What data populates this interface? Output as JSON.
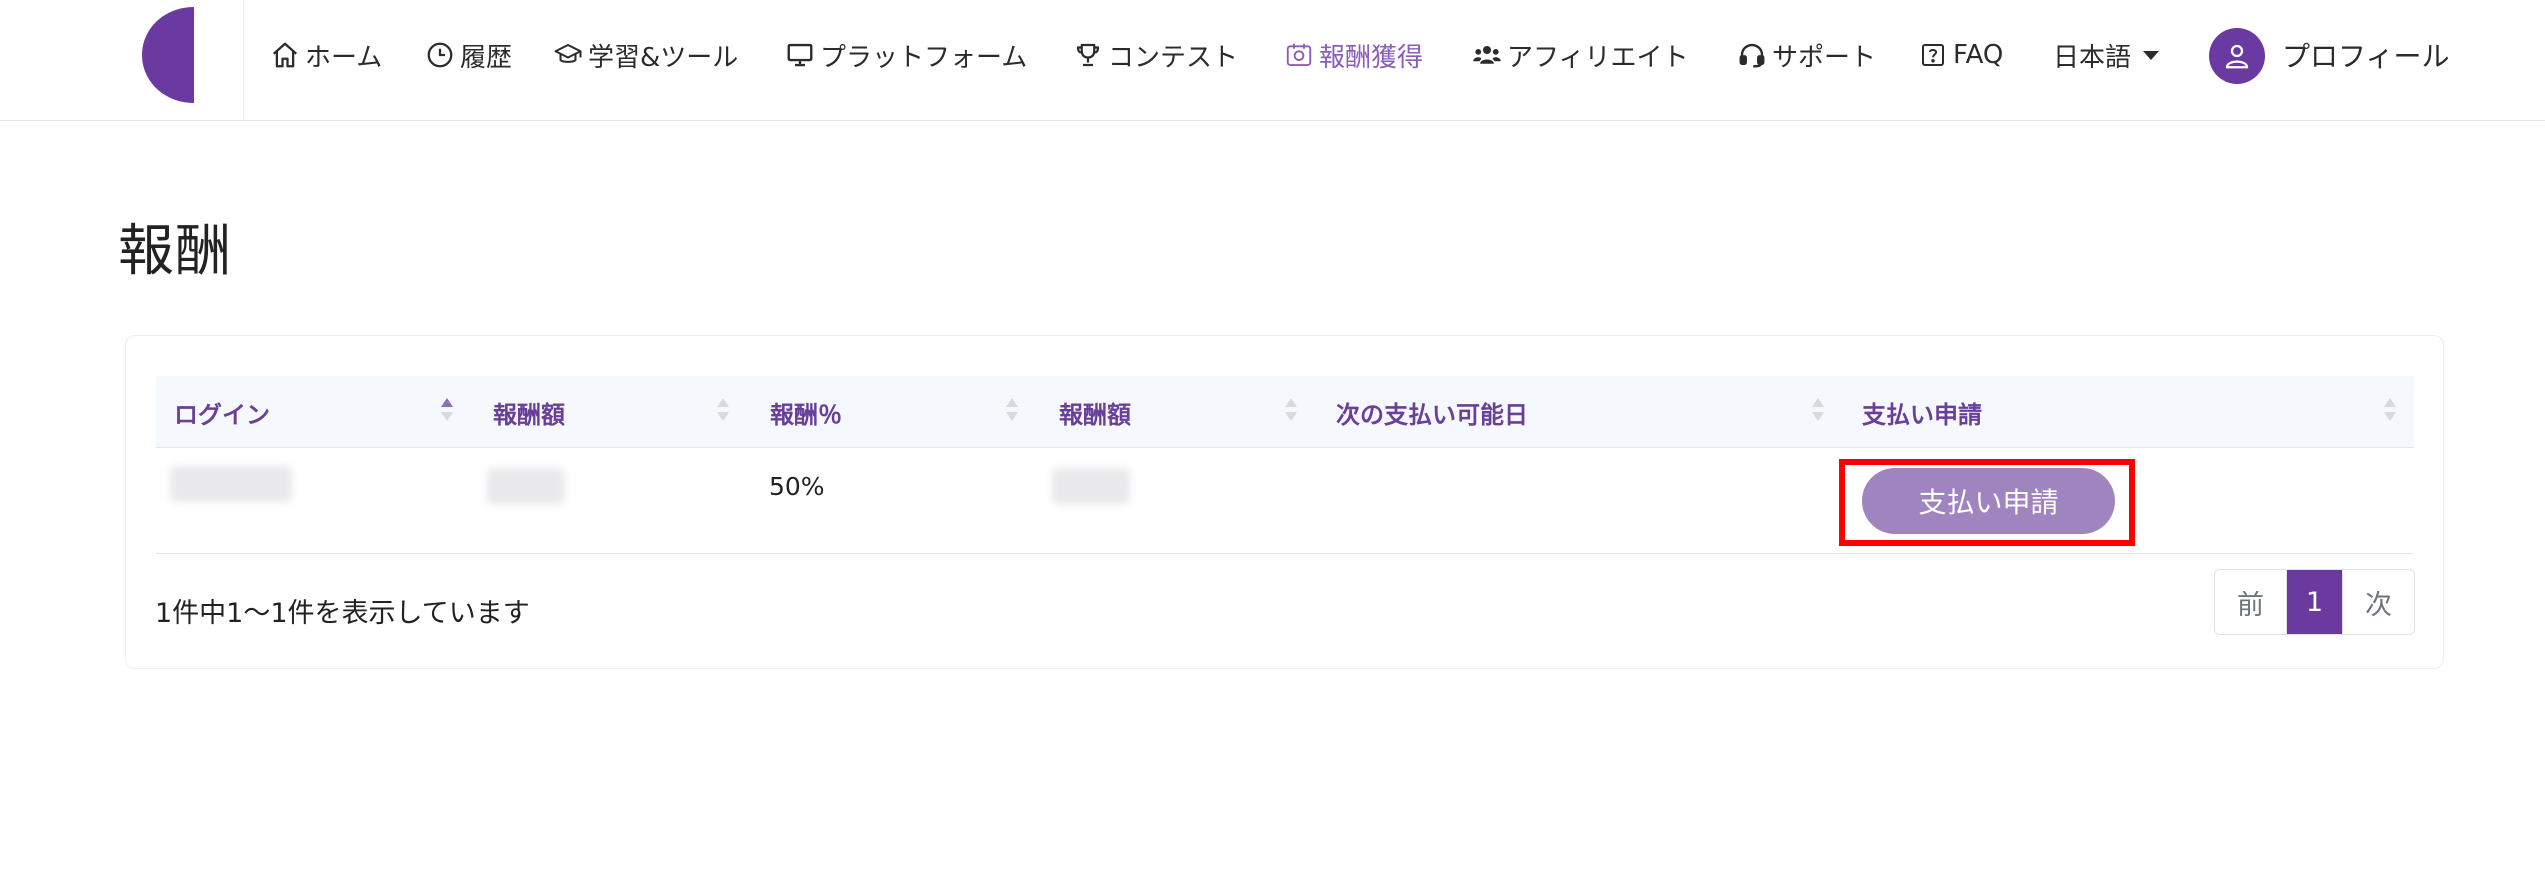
{
  "nav": {
    "items": [
      {
        "label": "ホーム",
        "icon": "home-icon"
      },
      {
        "label": "履歴",
        "icon": "clock-icon"
      },
      {
        "label": "学習&ツール",
        "icon": "graduation-cap-icon"
      },
      {
        "label": "プラットフォーム",
        "icon": "monitor-icon"
      },
      {
        "label": "コンテスト",
        "icon": "trophy-icon"
      },
      {
        "label": "報酬獲得",
        "icon": "reward-icon",
        "active": true
      },
      {
        "label": "アフィリエイト",
        "icon": "users-icon"
      },
      {
        "label": "サポート",
        "icon": "headset-icon"
      },
      {
        "label": "FAQ",
        "icon": "question-box-icon"
      }
    ],
    "language": "日本語",
    "profile": "プロフィール"
  },
  "page": {
    "title": "報酬"
  },
  "table": {
    "columns": [
      "ログイン",
      "報酬額",
      "報酬％",
      "報酬額",
      "次の支払い可能日",
      "支払い申請"
    ],
    "rows": [
      {
        "login": "",
        "reward_amount": "",
        "reward_percent": "50%",
        "reward_amount_2": "",
        "next_pay_date": "",
        "action": "支払い申請"
      }
    ]
  },
  "footer": {
    "info": "1件中1〜1件を表示しています",
    "prev": "前",
    "current_page": "1",
    "next": "次"
  },
  "colors": {
    "brand": "#6b3aa0",
    "active_nav": "#8a5db6",
    "button": "#9f84bf",
    "highlight": "#ff0000"
  }
}
